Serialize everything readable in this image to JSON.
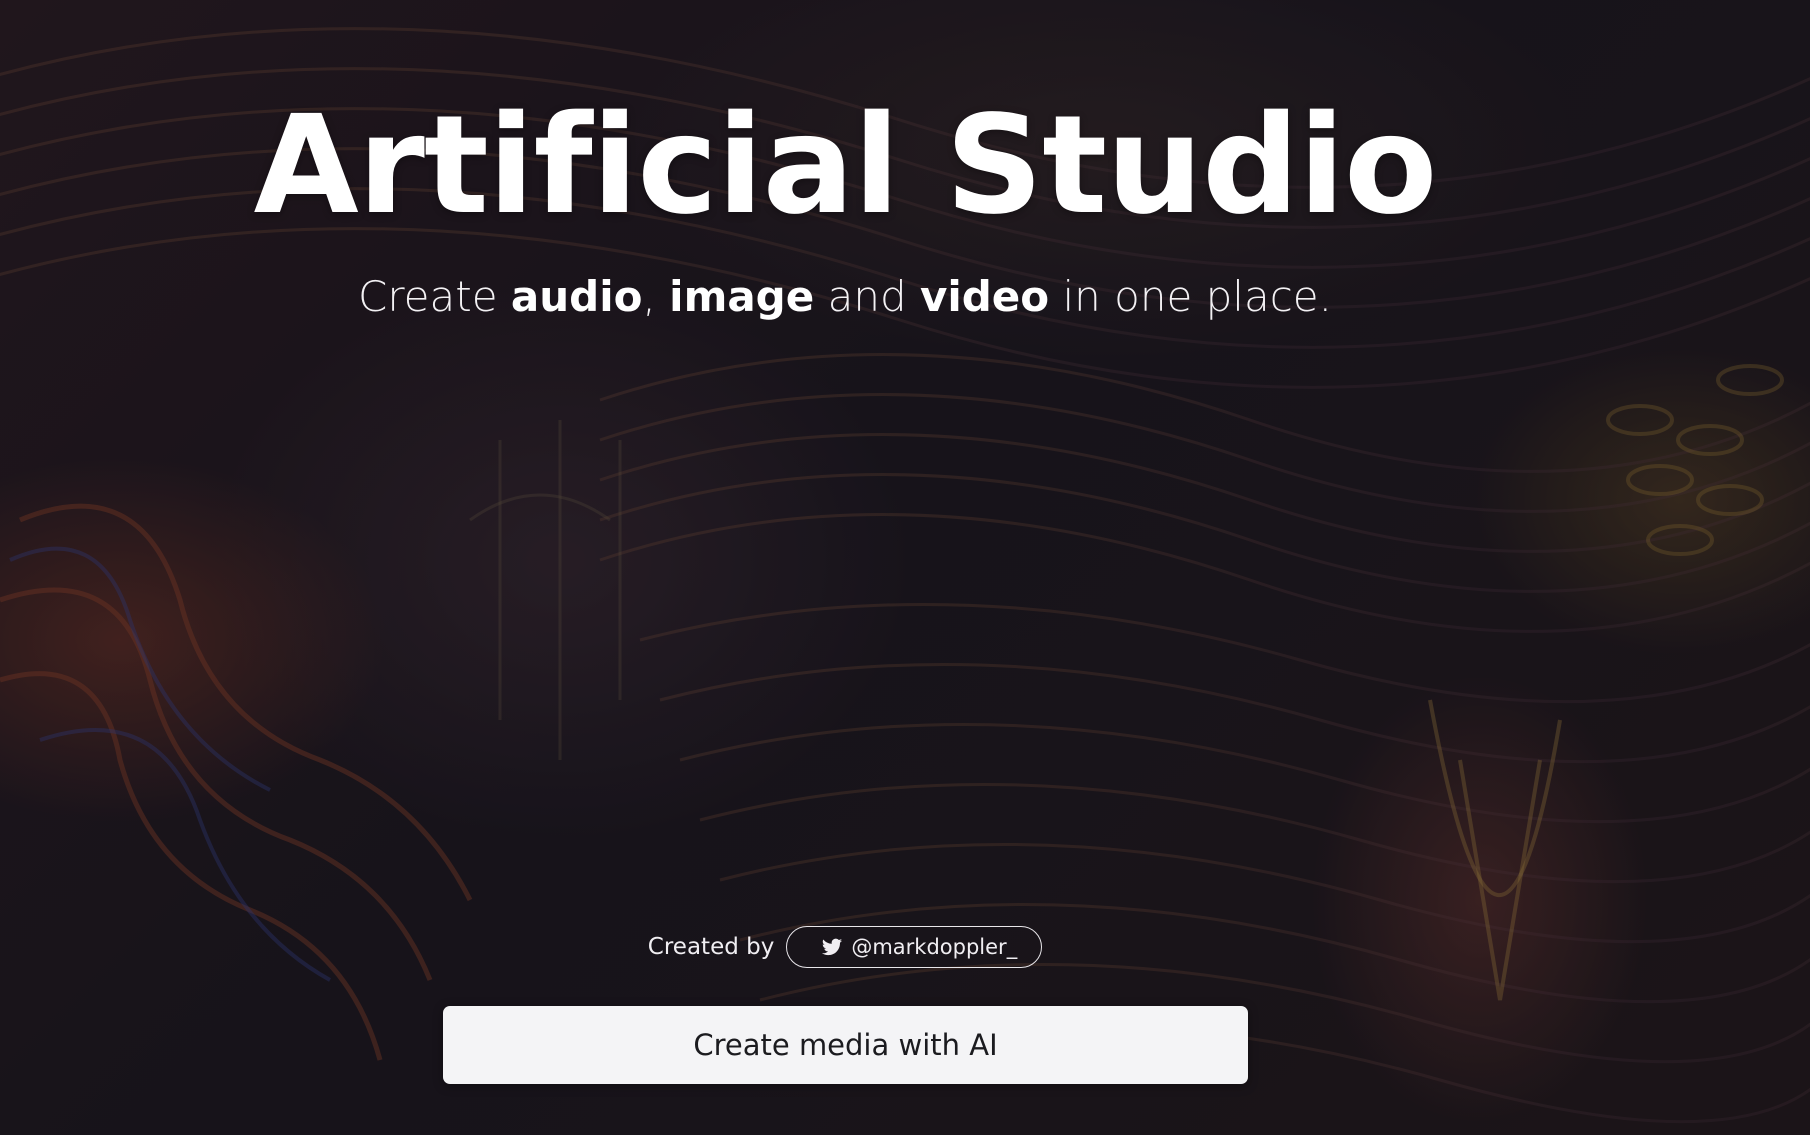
{
  "hero": {
    "title": "Artificial Studio",
    "subtitle": {
      "prefix": "Create ",
      "word1": "audio",
      "sep1": ", ",
      "word2": "image",
      "sep2": " and ",
      "word3": "video",
      "suffix": " in one place."
    }
  },
  "credit": {
    "label": "Created by",
    "handle": "@markdoppler_",
    "icon": "twitter-icon"
  },
  "cta": {
    "label": "Create media with AI"
  },
  "colors": {
    "button_bg": "#f4f4f6",
    "button_text": "#1b1b1f",
    "text": "#ffffff"
  }
}
